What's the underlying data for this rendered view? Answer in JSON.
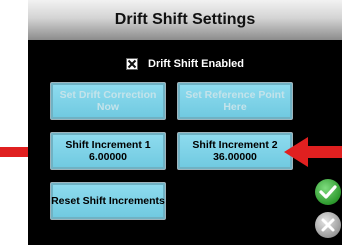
{
  "dialog": {
    "title": "Drift Shift Settings",
    "checkbox_label": "Drift Shift Enabled",
    "checkbox_checked": true
  },
  "buttons": {
    "set_drift_correction": {
      "line1": "Set Drift Correction",
      "line2": "Now",
      "enabled": false
    },
    "set_reference_point": {
      "line1": "Set Reference Point",
      "line2": "Here",
      "enabled": false
    },
    "shift_increment_1": {
      "line1": "Shift Increment 1",
      "line2": "6.00000",
      "enabled": true
    },
    "shift_increment_2": {
      "line1": "Shift Increment 2",
      "line2": "36.00000",
      "enabled": true
    },
    "reset_shift_increments": {
      "label": "Reset Shift Increments",
      "enabled": true
    }
  },
  "actions": {
    "confirm_icon": "green-check-icon",
    "cancel_icon": "gray-x-icon"
  },
  "annotations": {
    "arrow_color": "#e02020"
  },
  "colors": {
    "button_fill": "#7fd4e9",
    "panel_background": "#000000",
    "confirm": "#2e9a2e",
    "cancel": "#9a9a9a"
  }
}
